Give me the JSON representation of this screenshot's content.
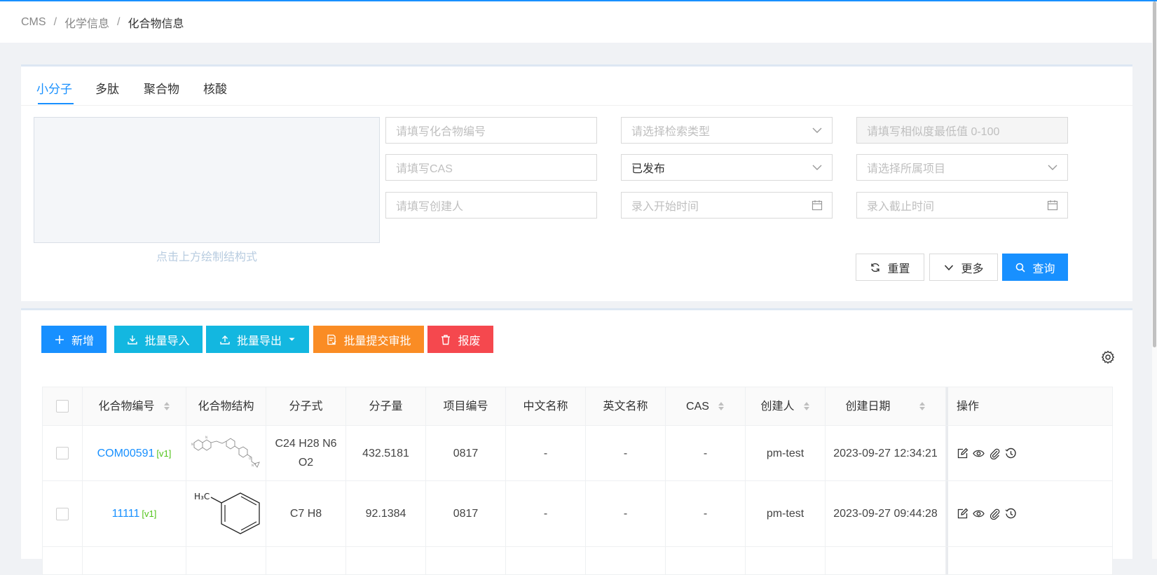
{
  "breadcrumb": [
    "CMS",
    "化学信息",
    "化合物信息"
  ],
  "breadcrumb_sep": "/",
  "tabs": [
    "小分子",
    "多肽",
    "聚合物",
    "核酸"
  ],
  "draw_hint": "点击上方绘制结构式",
  "filters": {
    "compound_no": "请填写化合物编号",
    "search_type": "请选择检索类型",
    "similarity": "请填写相似度最低值 0-100",
    "cas": "请填写CAS",
    "status": "已发布",
    "project": "请选择所属项目",
    "creator": "请填写创建人",
    "start_time": "录入开始时间",
    "end_time": "录入截止时间"
  },
  "search_buttons": {
    "reset": "重置",
    "more": "更多",
    "query": "查询"
  },
  "toolbar": {
    "add": "新增",
    "import": "批量导入",
    "export": "批量导出",
    "submit": "批量提交审批",
    "discard": "报废"
  },
  "columns": [
    "化合物编号",
    "化合物结构",
    "分子式",
    "分子量",
    "项目编号",
    "中文名称",
    "英文名称",
    "CAS",
    "创建人",
    "创建日期",
    "操作"
  ],
  "rows": [
    {
      "code": "COM00591",
      "version": "[v1]",
      "formula": "C24 H28 N6 O2",
      "mw": "432.5181",
      "project": "0817",
      "cn_name": "-",
      "en_name": "-",
      "cas": "-",
      "creator": "pm-test",
      "date": "2023-09-27 12:34:21"
    },
    {
      "code": "11111",
      "version": "[v1]",
      "formula": "C7 H8",
      "mw": "92.1384",
      "project": "0817",
      "cn_name": "-",
      "en_name": "-",
      "cas": "-",
      "creator": "pm-test",
      "date": "2023-09-27 09:44:28",
      "structure_label": "H₃C"
    }
  ],
  "colors": {
    "primary": "#1890ff",
    "cyan": "#13b7e0",
    "orange": "#fa8c24",
    "red": "#f5484e",
    "version_green": "#52c41a"
  },
  "icons": [
    "refresh-icon",
    "chevron-down-icon",
    "search-icon",
    "plus-icon",
    "download-icon",
    "upload-icon",
    "document-icon",
    "trash-icon",
    "gear-icon",
    "calendar-icon",
    "edit-icon",
    "eye-icon",
    "paperclip-icon",
    "history-icon",
    "sort-icon"
  ]
}
